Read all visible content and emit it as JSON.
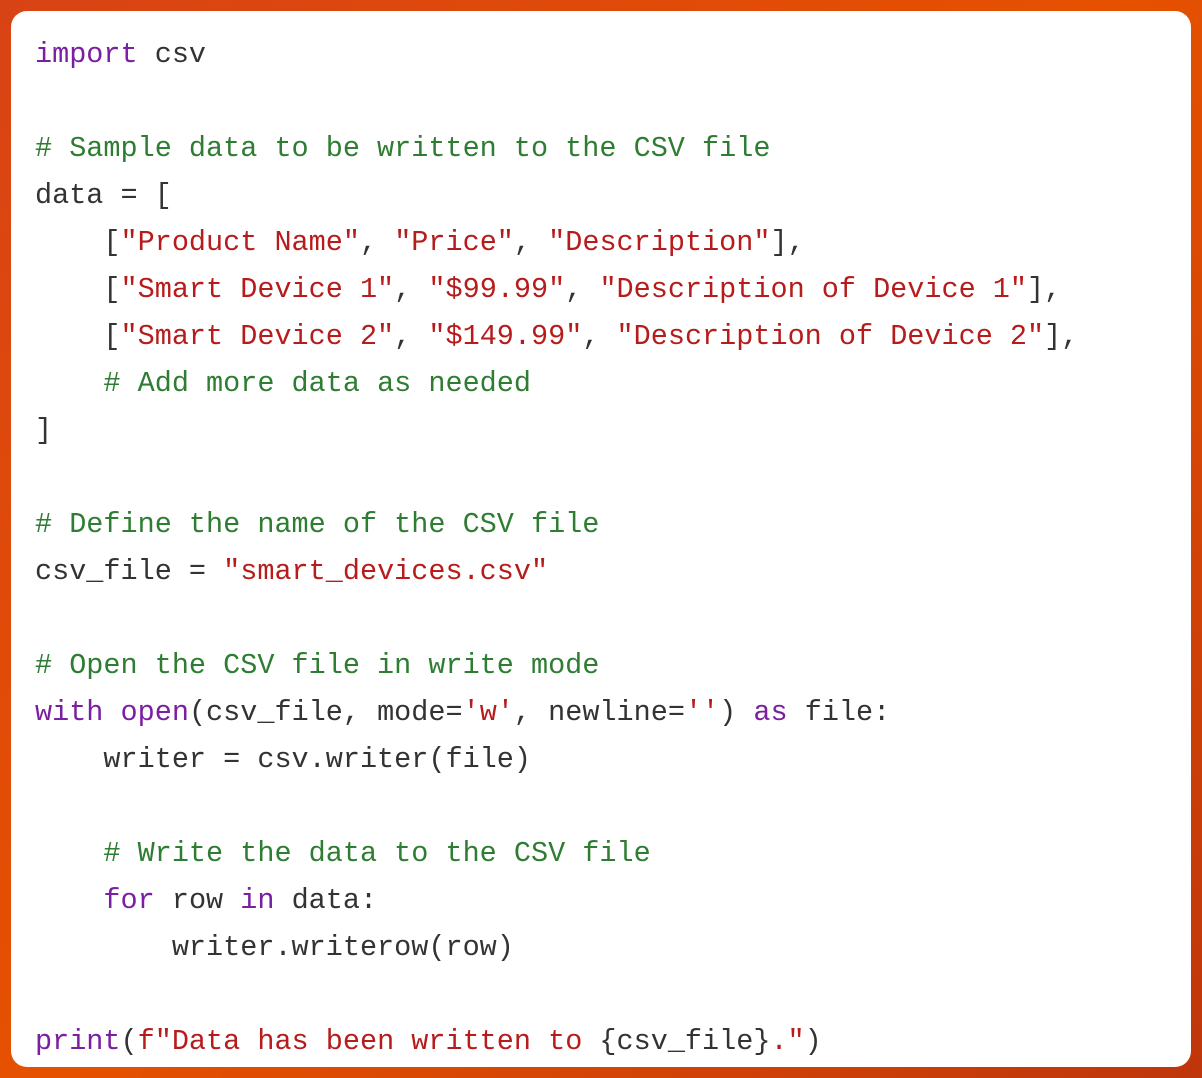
{
  "code": {
    "lines": [
      [
        {
          "cls": "tok-keyword",
          "text": "import"
        },
        {
          "cls": "tok-text",
          "text": " csv"
        }
      ],
      [],
      [
        {
          "cls": "tok-comment",
          "text": "# Sample data to be written to the CSV file"
        }
      ],
      [
        {
          "cls": "tok-text",
          "text": "data = ["
        }
      ],
      [
        {
          "cls": "tok-text",
          "text": "    ["
        },
        {
          "cls": "tok-string",
          "text": "\"Product Name\""
        },
        {
          "cls": "tok-text",
          "text": ", "
        },
        {
          "cls": "tok-string",
          "text": "\"Price\""
        },
        {
          "cls": "tok-text",
          "text": ", "
        },
        {
          "cls": "tok-string",
          "text": "\"Description\""
        },
        {
          "cls": "tok-text",
          "text": "],"
        }
      ],
      [
        {
          "cls": "tok-text",
          "text": "    ["
        },
        {
          "cls": "tok-string",
          "text": "\"Smart Device 1\""
        },
        {
          "cls": "tok-text",
          "text": ", "
        },
        {
          "cls": "tok-string",
          "text": "\"$99.99\""
        },
        {
          "cls": "tok-text",
          "text": ", "
        },
        {
          "cls": "tok-string",
          "text": "\"Description of Device 1\""
        },
        {
          "cls": "tok-text",
          "text": "],"
        }
      ],
      [
        {
          "cls": "tok-text",
          "text": "    ["
        },
        {
          "cls": "tok-string",
          "text": "\"Smart Device 2\""
        },
        {
          "cls": "tok-text",
          "text": ", "
        },
        {
          "cls": "tok-string",
          "text": "\"$149.99\""
        },
        {
          "cls": "tok-text",
          "text": ", "
        },
        {
          "cls": "tok-string",
          "text": "\"Description of Device 2\""
        },
        {
          "cls": "tok-text",
          "text": "],"
        }
      ],
      [
        {
          "cls": "tok-text",
          "text": "    "
        },
        {
          "cls": "tok-comment",
          "text": "# Add more data as needed"
        }
      ],
      [
        {
          "cls": "tok-text",
          "text": "]"
        }
      ],
      [],
      [
        {
          "cls": "tok-comment",
          "text": "# Define the name of the CSV file"
        }
      ],
      [
        {
          "cls": "tok-text",
          "text": "csv_file = "
        },
        {
          "cls": "tok-string",
          "text": "\"smart_devices.csv\""
        }
      ],
      [],
      [
        {
          "cls": "tok-comment",
          "text": "# Open the CSV file in write mode"
        }
      ],
      [
        {
          "cls": "tok-keyword",
          "text": "with"
        },
        {
          "cls": "tok-text",
          "text": " "
        },
        {
          "cls": "tok-builtin",
          "text": "open"
        },
        {
          "cls": "tok-text",
          "text": "(csv_file, mode="
        },
        {
          "cls": "tok-string",
          "text": "'w'"
        },
        {
          "cls": "tok-text",
          "text": ", newline="
        },
        {
          "cls": "tok-string",
          "text": "''"
        },
        {
          "cls": "tok-text",
          "text": ") "
        },
        {
          "cls": "tok-keyword",
          "text": "as"
        },
        {
          "cls": "tok-text",
          "text": " file:"
        }
      ],
      [
        {
          "cls": "tok-text",
          "text": "    writer = csv.writer(file)"
        }
      ],
      [],
      [
        {
          "cls": "tok-text",
          "text": "    "
        },
        {
          "cls": "tok-comment",
          "text": "# Write the data to the CSV file"
        }
      ],
      [
        {
          "cls": "tok-text",
          "text": "    "
        },
        {
          "cls": "tok-keyword",
          "text": "for"
        },
        {
          "cls": "tok-text",
          "text": " row "
        },
        {
          "cls": "tok-keyword",
          "text": "in"
        },
        {
          "cls": "tok-text",
          "text": " data:"
        }
      ],
      [
        {
          "cls": "tok-text",
          "text": "        writer.writerow(row)"
        }
      ],
      [],
      [
        {
          "cls": "tok-builtin",
          "text": "print"
        },
        {
          "cls": "tok-text",
          "text": "("
        },
        {
          "cls": "tok-string",
          "text": "f\"Data has been written to "
        },
        {
          "cls": "tok-text",
          "text": "{csv_file}"
        },
        {
          "cls": "tok-string",
          "text": ".\""
        },
        {
          "cls": "tok-text",
          "text": ")"
        }
      ]
    ]
  }
}
